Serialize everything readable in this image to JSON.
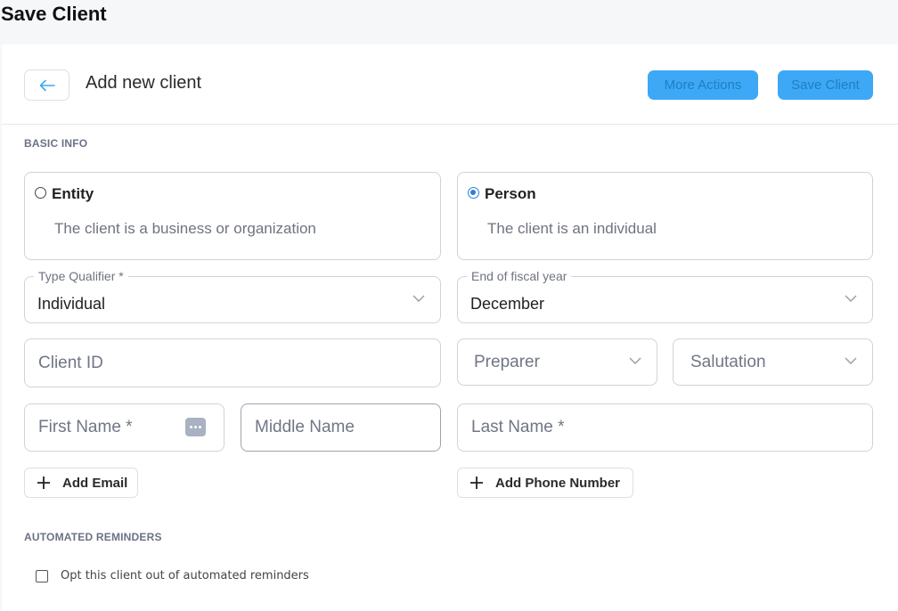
{
  "page": {
    "title": "Save Client"
  },
  "header": {
    "title": "Add new client",
    "more_actions_label": "More Actions",
    "save_label": "Save Client",
    "back_icon": "arrow-left-icon"
  },
  "basic_info": {
    "section_label": "BASIC INFO",
    "client_type": {
      "entity": {
        "title": "Entity",
        "description": "The client is a business or organization",
        "selected": false
      },
      "person": {
        "title": "Person",
        "description": "The client is an individual",
        "selected": true
      }
    },
    "type_qualifier": {
      "label": "Type Qualifier *",
      "value": "Individual"
    },
    "fiscal_year_end": {
      "label": "End of fiscal year",
      "value": "December"
    },
    "client_id": {
      "placeholder": "Client ID"
    },
    "preparer": {
      "placeholder": "Preparer"
    },
    "salutation": {
      "placeholder": "Salutation"
    },
    "first_name": {
      "placeholder": "First Name *"
    },
    "middle_name": {
      "placeholder": "Middle Name"
    },
    "last_name": {
      "placeholder": "Last Name *"
    },
    "add_email_label": "Add Email",
    "add_phone_label": "Add Phone Number"
  },
  "reminders": {
    "section_label": "AUTOMATED REMINDERS",
    "opt_out_label": "Opt this client out of automated reminders",
    "opt_out_checked": false
  },
  "colors": {
    "primary": "#3da8f5",
    "primary_text": "#1f7fc4",
    "radio_selected": "#2f7fd8"
  }
}
